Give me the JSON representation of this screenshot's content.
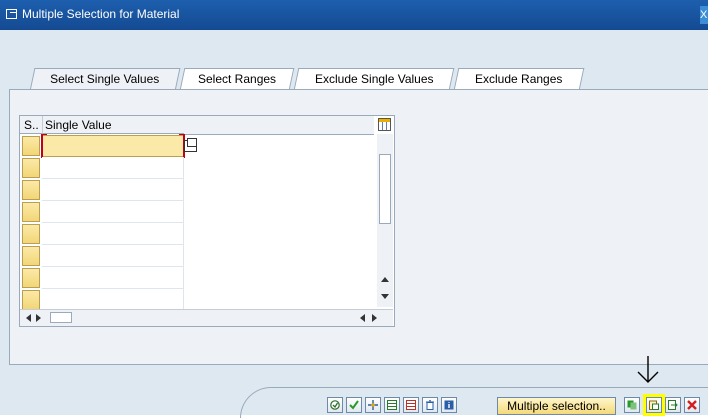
{
  "window": {
    "title": "Multiple Selection for Material",
    "close_label": "X"
  },
  "tabs": [
    {
      "label": "Select Single Values",
      "active": true
    },
    {
      "label": "Select Ranges",
      "active": false
    },
    {
      "label": "Exclude Single Values",
      "active": false
    },
    {
      "label": "Exclude Ranges",
      "active": false
    }
  ],
  "table": {
    "columns": [
      "S..",
      "Single Value"
    ],
    "rows": [
      "",
      "",
      "",
      "",
      "",
      "",
      "",
      ""
    ],
    "focused_row": 0
  },
  "toolbar": {
    "buttons": [
      {
        "name": "execute-button",
        "icon": "execute-icon"
      },
      {
        "name": "copy-button",
        "icon": "checkmark-icon"
      },
      {
        "name": "check-entries-button",
        "icon": "check-entries-icon"
      },
      {
        "name": "insert-row-button",
        "icon": "insert-row-icon"
      },
      {
        "name": "delete-row-button",
        "icon": "delete-row-icon"
      },
      {
        "name": "delete-all-button",
        "icon": "trash-icon"
      },
      {
        "name": "help-button",
        "icon": "info-icon"
      }
    ],
    "multiple_selection_label": "Multiple selection..",
    "buttons_after": [
      {
        "name": "import-button",
        "icon": "import-icon"
      },
      {
        "name": "upload-clipboard-button",
        "icon": "clipboard-paste-icon",
        "highlighted": true
      },
      {
        "name": "export-button",
        "icon": "export-icon"
      },
      {
        "name": "cancel-button",
        "icon": "cancel-icon"
      }
    ]
  },
  "annotation": {
    "arrow_color": "#000000",
    "highlight_color": "#ffff00"
  },
  "colors": {
    "titlebar": "#144a92",
    "background": "#dde8f1",
    "cell_focus": "#fbe9a7",
    "cell_focus_border": "#c0001f"
  }
}
